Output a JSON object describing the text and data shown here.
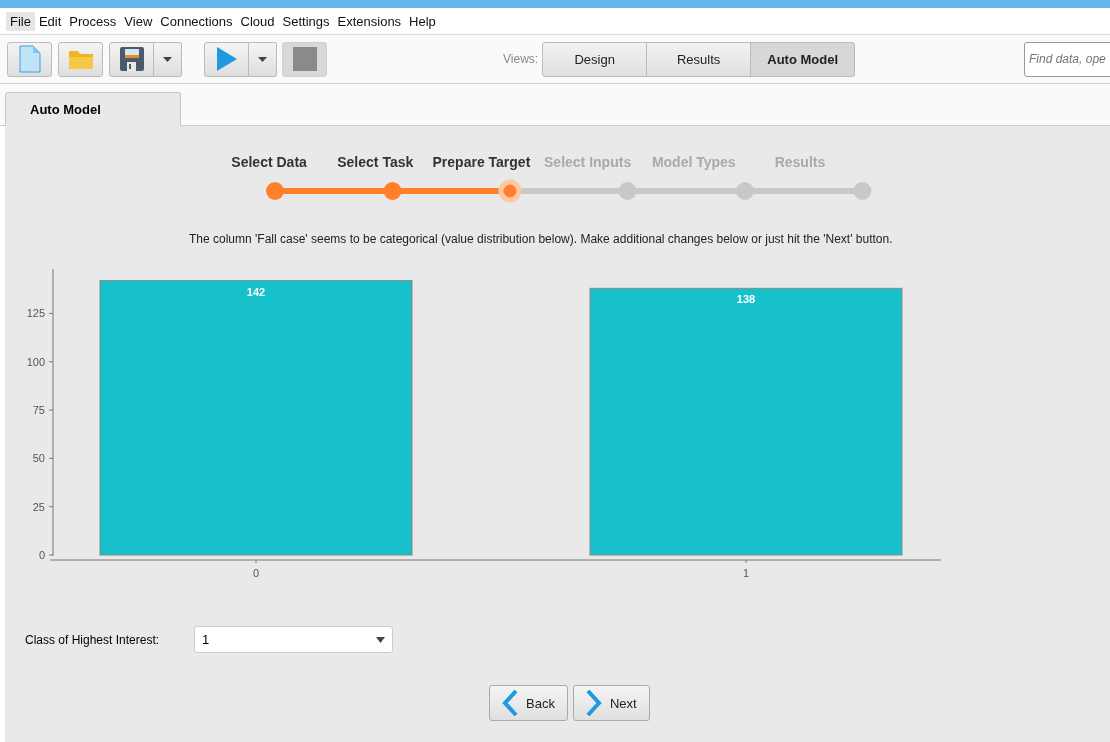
{
  "menu": [
    {
      "label": "File",
      "selected": true
    },
    {
      "label": "Edit",
      "selected": false
    },
    {
      "label": "Process",
      "selected": false
    },
    {
      "label": "View",
      "selected": false
    },
    {
      "label": "Connections",
      "selected": false
    },
    {
      "label": "Cloud",
      "selected": false
    },
    {
      "label": "Settings",
      "selected": false
    },
    {
      "label": "Extensions",
      "selected": false
    },
    {
      "label": "Help",
      "selected": false
    }
  ],
  "toolbar": {
    "views_label": "Views:",
    "views": [
      {
        "label": "Design",
        "selected": false
      },
      {
        "label": "Results",
        "selected": false
      },
      {
        "label": "Auto Model",
        "selected": true
      }
    ],
    "search": {
      "placeholder": "Find data, ope"
    }
  },
  "tab": {
    "label": "Auto Model"
  },
  "steps": [
    {
      "label": "Select Data",
      "completed": true,
      "selected": false
    },
    {
      "label": "Select Task",
      "completed": true,
      "selected": false
    },
    {
      "label": "Prepare Target",
      "completed": true,
      "selected": true
    },
    {
      "label": "Select Inputs",
      "completed": false,
      "selected": false
    },
    {
      "label": "Model Types",
      "completed": false,
      "selected": false
    },
    {
      "label": "Results",
      "completed": false,
      "selected": false
    }
  ],
  "message": "The column 'Fall case' seems to be categorical (value distribution below).  Make additional changes below or just hit the 'Next' button.",
  "chart_data": {
    "type": "bar",
    "categories": [
      "0",
      "1"
    ],
    "values": [
      142,
      138
    ],
    "ylim": [
      0,
      148
    ],
    "yticks": [
      0,
      25,
      50,
      75,
      100,
      125
    ],
    "data_labels": true
  },
  "class_field": {
    "label": "Class of Highest Interest:",
    "value": "1"
  },
  "buttons": [
    {
      "label": "Back",
      "kind": "back"
    },
    {
      "label": "Next",
      "kind": "next"
    }
  ]
}
